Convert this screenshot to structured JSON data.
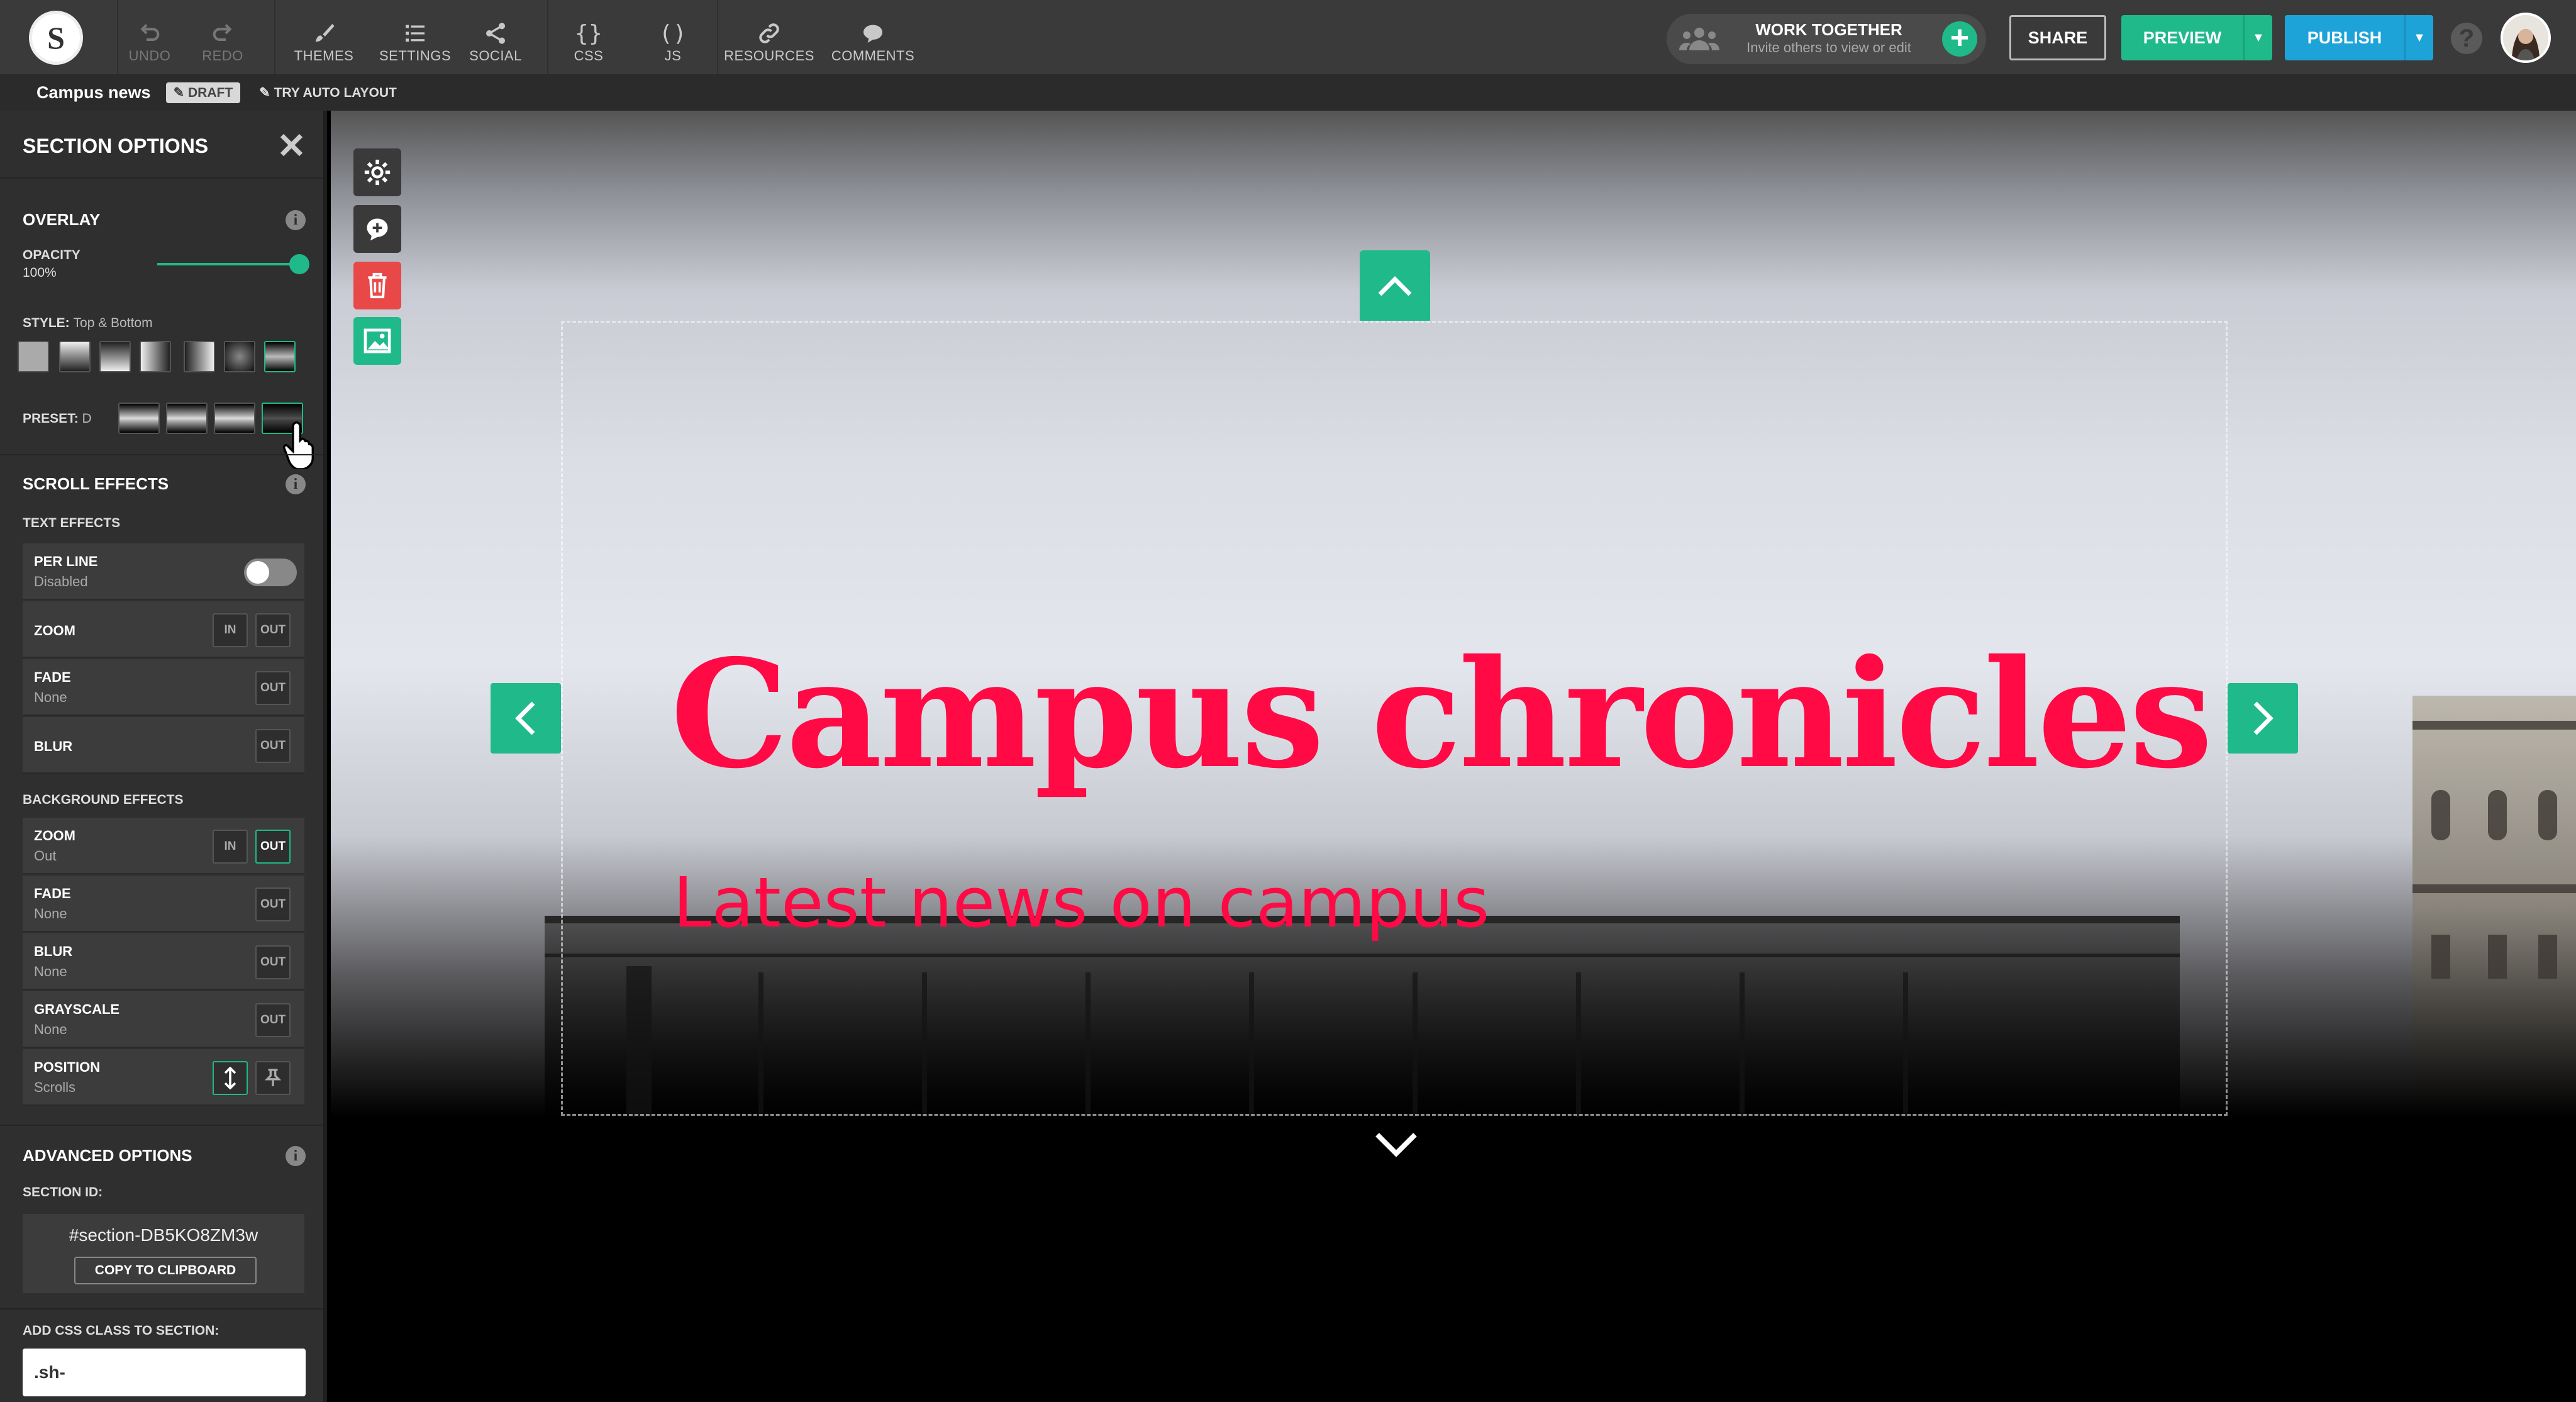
{
  "toolbar": {
    "logo_letter": "S",
    "undo": "UNDO",
    "redo": "REDO",
    "themes": "THEMES",
    "settings": "SETTINGS",
    "social": "SOCIAL",
    "css": "CSS",
    "js": "JS",
    "resources": "RESOURCES",
    "comments": "COMMENTS",
    "work_together_title": "WORK TOGETHER",
    "work_together_sub": "Invite others to view or edit",
    "share": "SHARE",
    "preview": "PREVIEW",
    "publish": "PUBLISH",
    "help": "?"
  },
  "subbar": {
    "page_name": "Campus news",
    "draft": "DRAFT",
    "auto_layout": "TRY AUTO LAYOUT"
  },
  "panel": {
    "title": "SECTION OPTIONS",
    "overlay": {
      "heading": "OVERLAY",
      "opacity_label": "OPACITY",
      "opacity_value": "100%",
      "opacity": 1.0,
      "style_label": "STYLE:",
      "style_value": "Top & Bottom",
      "preset_label": "PRESET:",
      "preset_value": "D"
    },
    "scroll": {
      "heading": "SCROLL EFFECTS",
      "text_effects": "TEXT EFFECTS",
      "per_line": "PER LINE",
      "per_line_value": "Disabled",
      "zoom": "ZOOM",
      "fade": "FADE",
      "fade_value": "None",
      "blur": "BLUR",
      "in": "IN",
      "out": "OUT",
      "bg_effects": "BACKGROUND EFFECTS",
      "bg_zoom": "ZOOM",
      "bg_zoom_value": "Out",
      "bg_fade": "FADE",
      "bg_fade_value": "None",
      "bg_blur": "BLUR",
      "bg_blur_value": "None",
      "grayscale": "GRAYSCALE",
      "grayscale_value": "None",
      "position": "POSITION",
      "position_value": "Scrolls"
    },
    "advanced": {
      "heading": "ADVANCED OPTIONS",
      "section_id_label": "SECTION ID:",
      "section_id": "#section-DB5KO8ZM3w",
      "copy": "COPY TO CLIPBOARD",
      "css_class_label": "ADD CSS CLASS TO SECTION:",
      "css_class_value": ".sh-"
    }
  },
  "canvas": {
    "heading": "Campus chronicles",
    "subheading": "Latest news on campus"
  },
  "colors": {
    "accent": "#1fb98a",
    "publish": "#1ea3d8",
    "heading": "#ff0a45",
    "delete": "#e84848"
  }
}
